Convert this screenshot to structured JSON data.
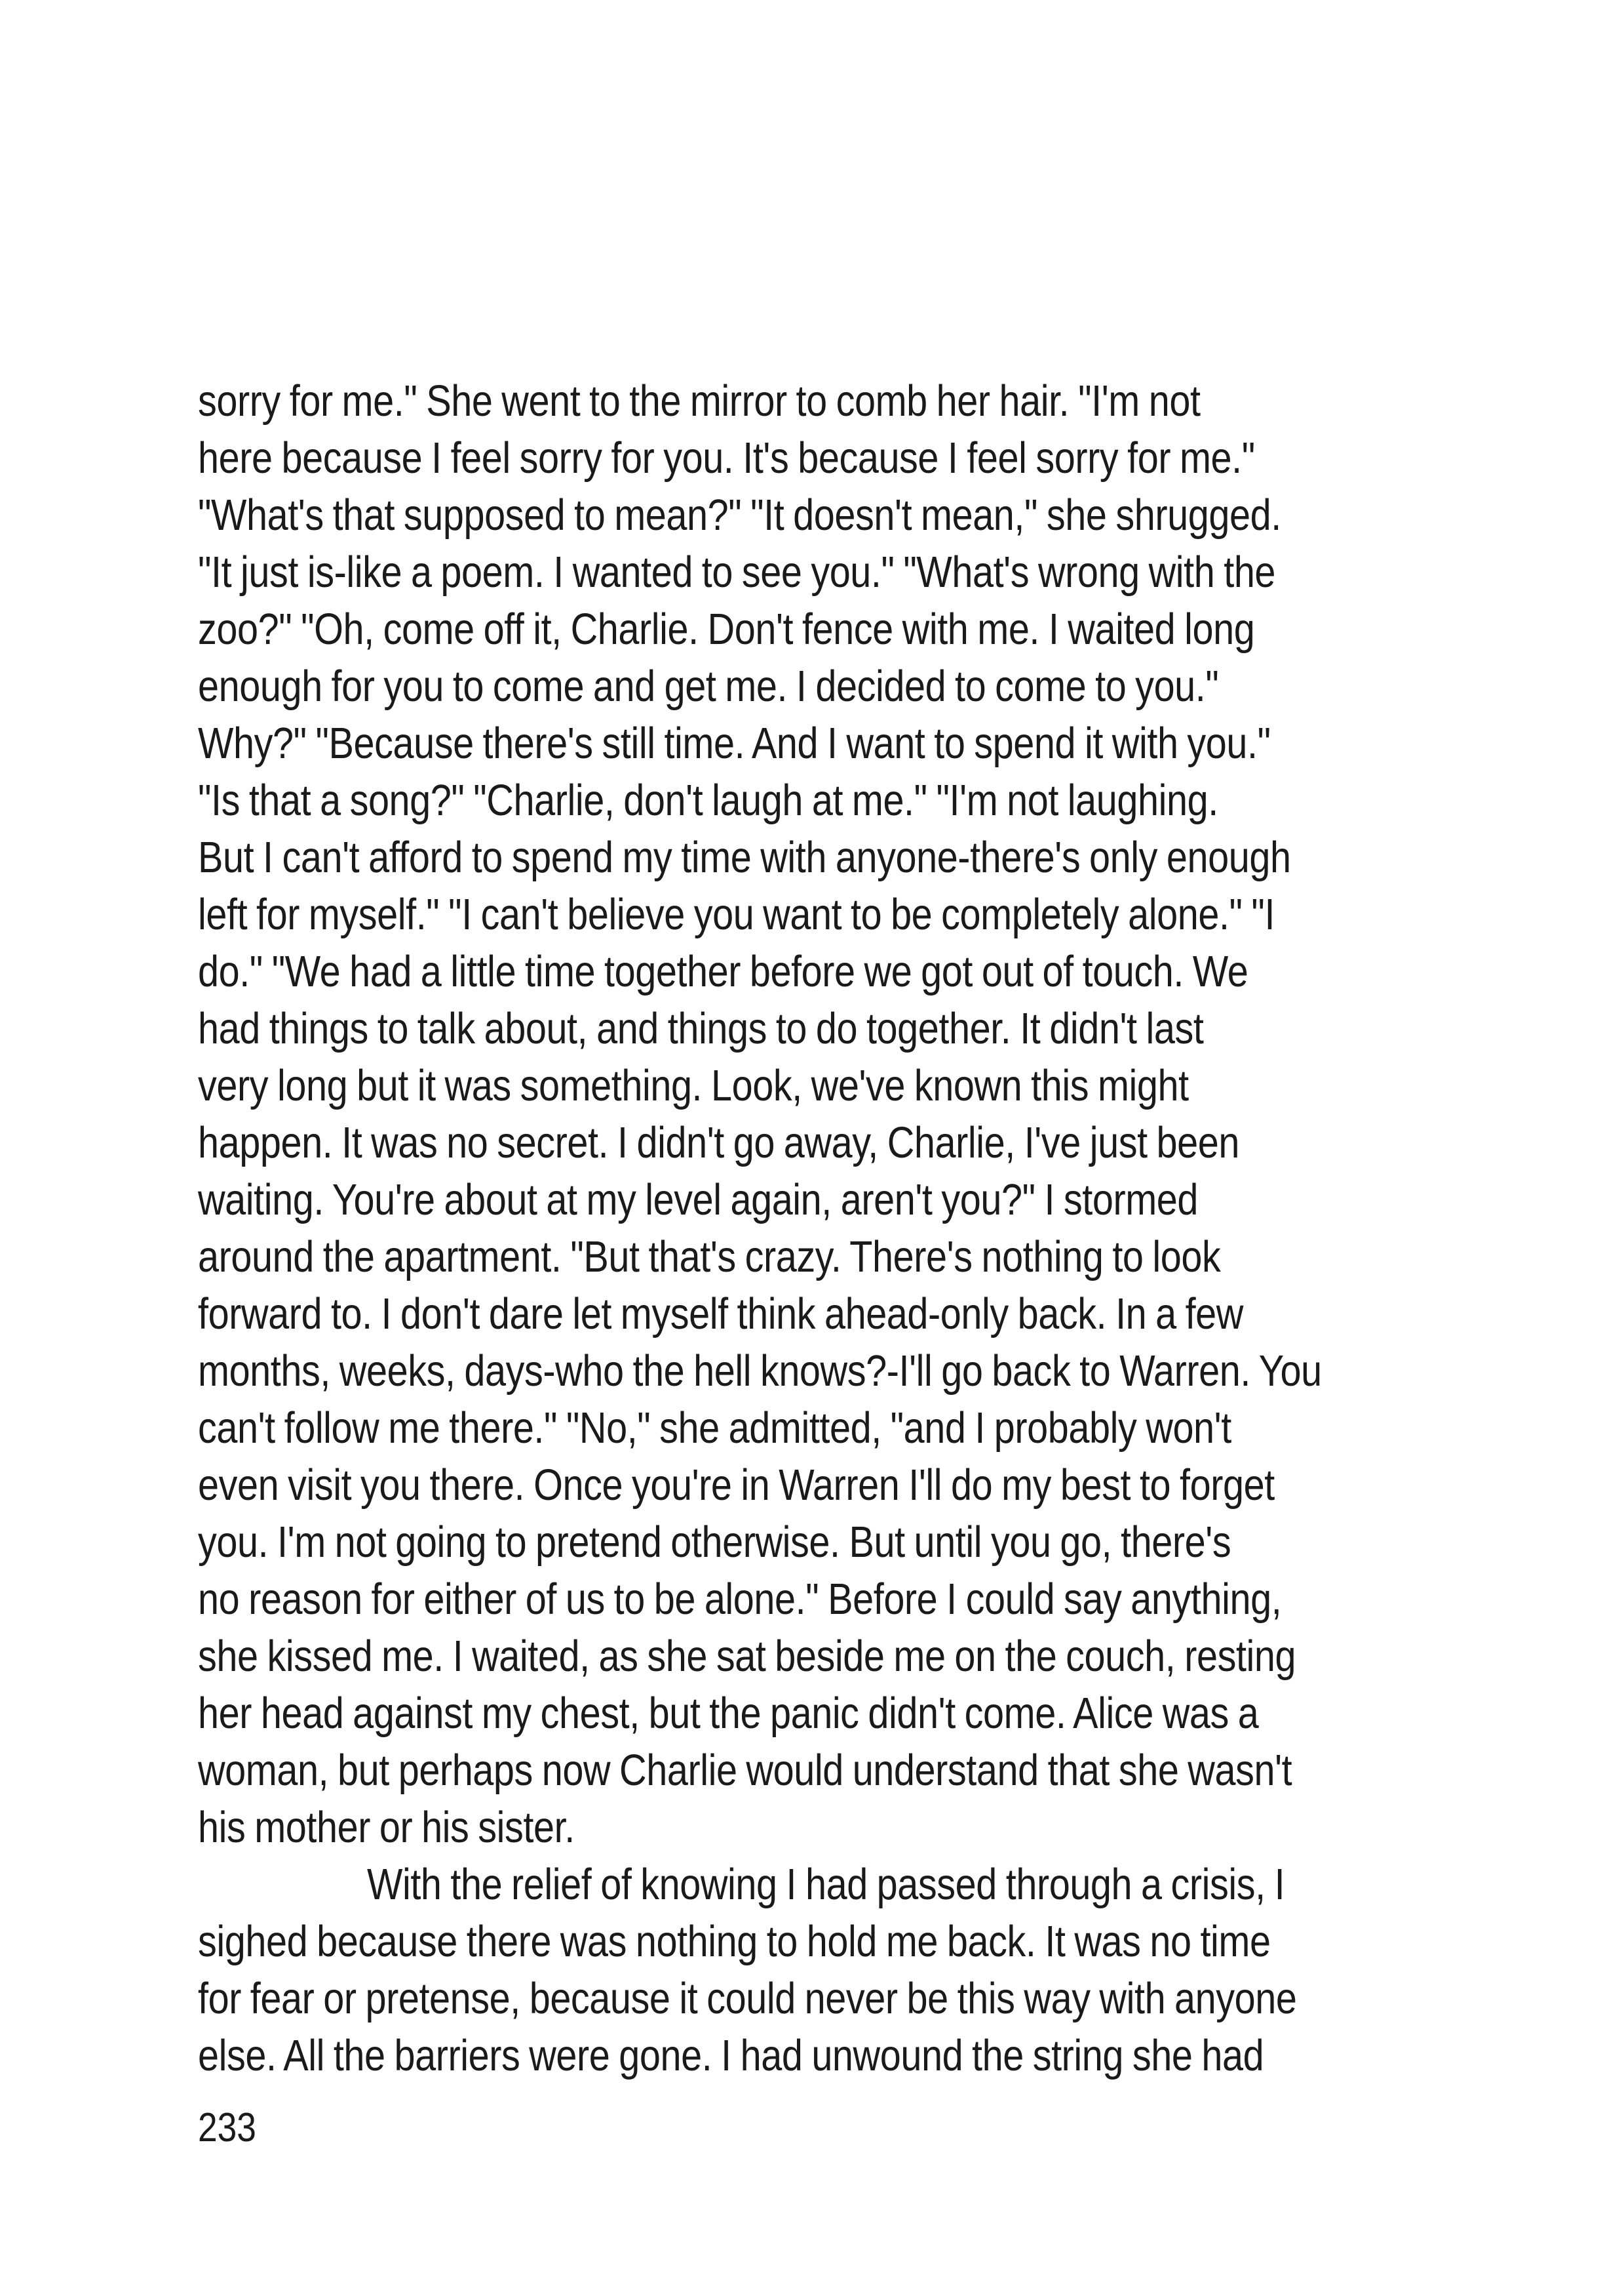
{
  "document": {
    "lines": [
      "sorry for me.\" She went to the mirror to comb her hair. \"I'm not",
      "here because I feel sorry for you. It's because I feel sorry for me.\"",
      "\"What's that supposed to mean?\" \"It doesn't mean,\" she shrugged.",
      "\"It just is-like a poem. I wanted to see you.\" \"What's wrong with the",
      "zoo?\" \"Oh, come off it, Charlie. Don't fence with me. I waited long",
      "enough for you to come and get me. I decided to come to you.\"",
      "Why?\" \"Because there's still time. And I want to spend it with you.\"",
      "\"Is that a song?\" \"Charlie, don't laugh at me.\" \"I'm not laughing.",
      "But I can't afford to spend my time with anyone-there's only enough",
      "left for myself.\" \"I can't believe you want to be completely alone.\" \"I",
      "do.\" \"We had a little time together before we got out of touch. We",
      "had things to talk about, and things to do together. It didn't last",
      "very long but it was something. Look, we've known this might",
      "happen. It was no secret. I didn't go away, Charlie, I've just been",
      "waiting. You're about at my level again, aren't you?\" I stormed",
      "around the apartment. \"But that's crazy. There's nothing to look",
      "forward to. I don't dare let myself think ahead-only back. In a few",
      "months, weeks, days-who the hell knows?-I'll go back to Warren. You",
      "can't follow me there.\" \"No,\" she admitted, \"and I probably won't",
      "even visit you there. Once you're in Warren I'll do my best to forget",
      "you. I'm not going to pretend otherwise. But until you go, there's",
      "no reason for either of us to be alone.\" Before I could say anything,",
      "she kissed me. I waited, as she sat beside me on the couch, resting",
      "her head against my chest, but the panic didn't come. Alice was a",
      "woman, but perhaps now Charlie would understand that she wasn't",
      "his mother or his sister.",
      "With the relief of knowing I had passed through a crisis, I",
      "sighed because there was nothing to hold me back. It was no time",
      "for fear or pretense, because it could never be this way with anyone",
      "else. All the barriers were gone. I had unwound the string she had"
    ],
    "page_number": "233"
  }
}
